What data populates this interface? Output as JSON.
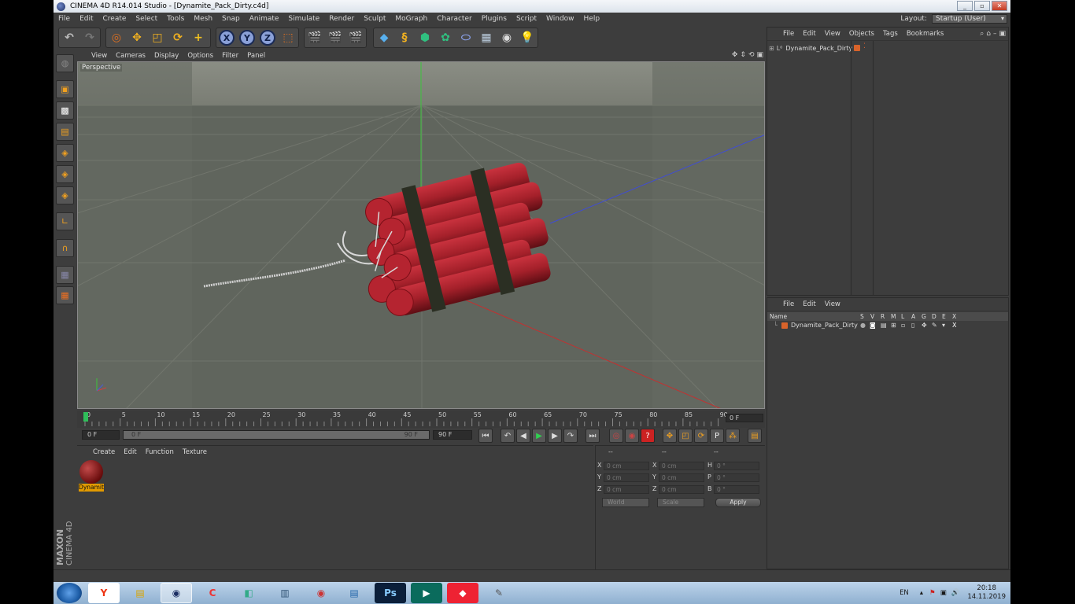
{
  "window": {
    "title": "CINEMA 4D R14.014 Studio - [Dynamite_Pack_Dirty.c4d]",
    "layout_label": "Layout:",
    "layout_value": "Startup (User)"
  },
  "menu": [
    "File",
    "Edit",
    "Create",
    "Select",
    "Tools",
    "Mesh",
    "Snap",
    "Animate",
    "Simulate",
    "Render",
    "Sculpt",
    "MoGraph",
    "Character",
    "Plugins",
    "Script",
    "Window",
    "Help"
  ],
  "toolbar": {
    "axis_x": "X",
    "axis_y": "Y",
    "axis_z": "Z"
  },
  "viewport": {
    "menu": [
      "View",
      "Cameras",
      "Display",
      "Options",
      "Filter",
      "Panel"
    ],
    "camera_label": "Perspective",
    "colors": {
      "background": "#5f645c",
      "grid": "#74786f",
      "object_red": "#b3222e",
      "band": "#2b2f23"
    }
  },
  "timeline": {
    "ticks": [
      "0",
      "5",
      "10",
      "15",
      "20",
      "25",
      "30",
      "35",
      "40",
      "45",
      "50",
      "55",
      "60",
      "65",
      "70",
      "75",
      "80",
      "85",
      "90"
    ],
    "current_frame": "0 F",
    "start_field": "0 F",
    "slider_start": "0 F",
    "slider_end": "90 F",
    "end_field": "90 F"
  },
  "material_manager": {
    "menu": [
      "Create",
      "Edit",
      "Function",
      "Texture"
    ],
    "material_name": "Dynamit"
  },
  "coordinates": {
    "headers": [
      "--",
      "--",
      "--"
    ],
    "rows": [
      {
        "a": "X",
        "av": "0 cm",
        "b": "X",
        "bv": "0 cm",
        "c": "H",
        "cv": "0 °"
      },
      {
        "a": "Y",
        "av": "0 cm",
        "b": "Y",
        "bv": "0 cm",
        "c": "P",
        "cv": "0 °"
      },
      {
        "a": "Z",
        "av": "0 cm",
        "b": "Z",
        "bv": "0 cm",
        "c": "B",
        "cv": "0 °"
      }
    ],
    "world": "World",
    "scale": "Scale",
    "apply": "Apply"
  },
  "object_manager": {
    "menu": [
      "File",
      "Edit",
      "View",
      "Objects",
      "Tags",
      "Bookmarks"
    ],
    "object_name": "Dynamite_Pack_Dirty"
  },
  "layer_manager": {
    "menu": [
      "File",
      "Edit",
      "View"
    ],
    "columns": [
      "Name",
      "S",
      "V",
      "R",
      "M",
      "L",
      "A",
      "G",
      "D",
      "E",
      "X"
    ],
    "layer_name": "Dynamite_Pack_Dirty"
  },
  "branding": {
    "maxon": "MAXON",
    "c4d": "CINEMA 4D"
  },
  "taskbar": {
    "lang": "EN",
    "time": "20:18",
    "date": "14.11.2019"
  }
}
